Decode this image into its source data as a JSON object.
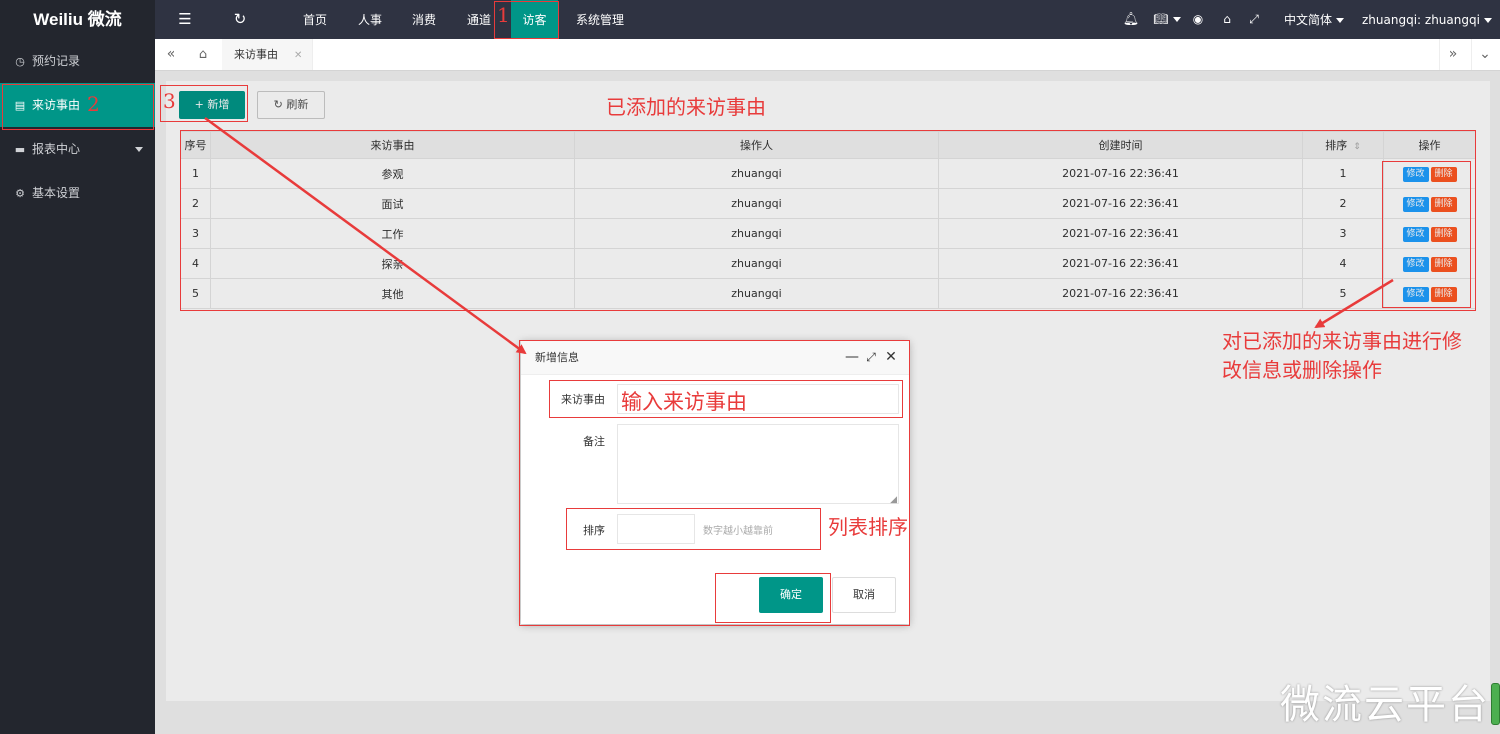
{
  "app": {
    "logo": "Weiliu 微流"
  },
  "topbar": {
    "nav": [
      "首页",
      "人事",
      "消费",
      "通道",
      "访客",
      "系统管理"
    ],
    "active_nav": "访客",
    "language": "中文简体",
    "user": "zhuangqi: zhuangqi"
  },
  "sidebar": {
    "items": [
      {
        "label": "预约记录",
        "icon": "clock-icon"
      },
      {
        "label": "来访事由",
        "icon": "clipboard-icon"
      },
      {
        "label": "报表中心",
        "icon": "chart-icon"
      },
      {
        "label": "基本设置",
        "icon": "gear-icon"
      }
    ]
  },
  "tabs": {
    "active": "来访事由"
  },
  "toolbar": {
    "add_label": "+ 新增",
    "refresh_label": "刷新"
  },
  "table": {
    "headers": [
      "序号",
      "来访事由",
      "操作人",
      "创建时间",
      "排序",
      "操作"
    ],
    "edit_label": "修改",
    "delete_label": "删除",
    "rows": [
      [
        "1",
        "参观",
        "zhuangqi",
        "2021-07-16 22:36:41",
        "1"
      ],
      [
        "2",
        "面试",
        "zhuangqi",
        "2021-07-16 22:36:41",
        "2"
      ],
      [
        "3",
        "工作",
        "zhuangqi",
        "2021-07-16 22:36:41",
        "3"
      ],
      [
        "4",
        "探亲",
        "zhuangqi",
        "2021-07-16 22:36:41",
        "4"
      ],
      [
        "5",
        "其他",
        "zhuangqi",
        "2021-07-16 22:36:41",
        "5"
      ]
    ]
  },
  "dialog": {
    "title": "新增信息",
    "reason_label": "来访事由",
    "remark_label": "备注",
    "order_label": "排序",
    "order_hint": "数字越小越靠前",
    "ok_label": "确定",
    "cancel_label": "取消"
  },
  "annotations": {
    "n1": "1",
    "n2": "2",
    "n3": "3",
    "added_reasons": "已添加的来访事由",
    "enter_reason": "输入来访事由",
    "list_order": "列表排序",
    "edit_note_1": "对已添加的来访事由进行修",
    "edit_note_2": "改信息或删除操作"
  },
  "watermark": "微流云平台",
  "colors": {
    "accent": "#009688",
    "annotation": "#e83b3b",
    "edit": "#1e9fff",
    "delete": "#ff5722"
  }
}
